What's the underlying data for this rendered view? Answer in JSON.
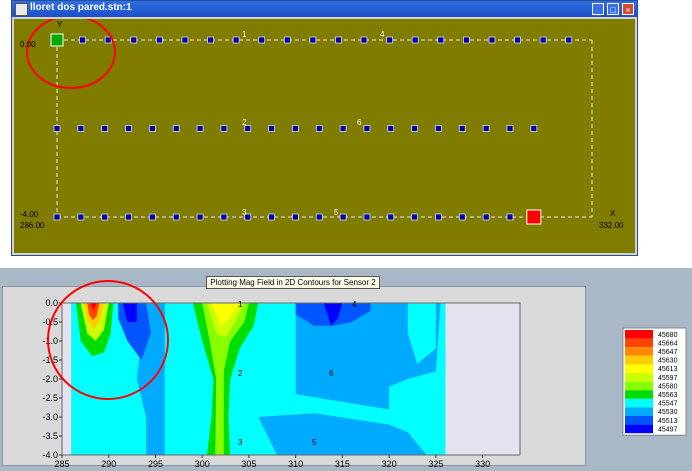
{
  "window": {
    "title": "lloret dos pared.stn:1",
    "buttons": [
      "_",
      "□",
      "×"
    ]
  },
  "layout_view": {
    "axis_y_label": "Y",
    "axis_x_label": "X",
    "y_top_label": "0.00",
    "y_bottom_label": "-4.00",
    "x_left_label": "286.00",
    "x_right_label": "332.00",
    "line_labels": [
      "1",
      "4",
      "2",
      "6",
      "3",
      "5"
    ],
    "colors": {
      "background": "#807c00",
      "sensor": "#0000aa",
      "start_marker": "#00aa00",
      "end_marker": "#ff0000",
      "highlight": "#ff0000"
    },
    "rows": [
      {
        "y": 0,
        "x_start": 286,
        "x_end": 330
      },
      {
        "y": -2,
        "x_start": 286,
        "x_end": 327
      },
      {
        "y": -4,
        "x_start": 286,
        "x_end": 327
      }
    ]
  },
  "contour_panel": {
    "title": "Plotting Mag Field in 2D Contours for Sensor 2",
    "point_labels": [
      "1",
      "4",
      "2",
      "6",
      "3",
      "5"
    ],
    "chart_data": {
      "type": "heatmap",
      "x_ticks": [
        285,
        290,
        295,
        300,
        305,
        310,
        315,
        320,
        325,
        330
      ],
      "y_ticks": [
        0.0,
        -0.5,
        -1.0,
        -1.5,
        -2.0,
        -2.5,
        -3.0,
        -3.5,
        -4.0
      ],
      "xlim": [
        285,
        334
      ],
      "ylim": [
        -4.0,
        0.0
      ],
      "data_x_range": [
        286,
        326
      ],
      "legend_values": [
        45680,
        45664,
        45647,
        45630,
        45613,
        45597,
        45580,
        45563,
        45547,
        45530,
        45513,
        45497
      ],
      "legend_colors": [
        "#ff0000",
        "#ff4400",
        "#ff8800",
        "#ffcc00",
        "#ffff00",
        "#ccff00",
        "#88ff00",
        "#00dd00",
        "#00ffff",
        "#00aaff",
        "#0055ff",
        "#0000ff"
      ]
    }
  }
}
